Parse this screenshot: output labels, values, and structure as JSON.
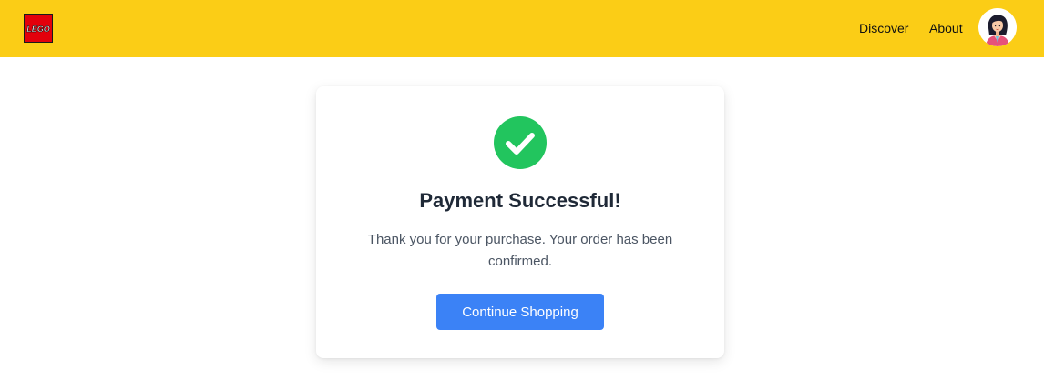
{
  "header": {
    "logo_text": "LEGO",
    "nav": [
      {
        "label": "Discover"
      },
      {
        "label": "About"
      }
    ],
    "brand_color": "#fbcd16",
    "logo_color": "#e3000b"
  },
  "confirmation": {
    "icon": "check-circle-icon",
    "icon_color": "#22c55e",
    "title": "Payment Successful!",
    "message": "Thank you for your purchase. Your order has been confirmed.",
    "button_label": "Continue Shopping",
    "button_color": "#3b82f6"
  }
}
